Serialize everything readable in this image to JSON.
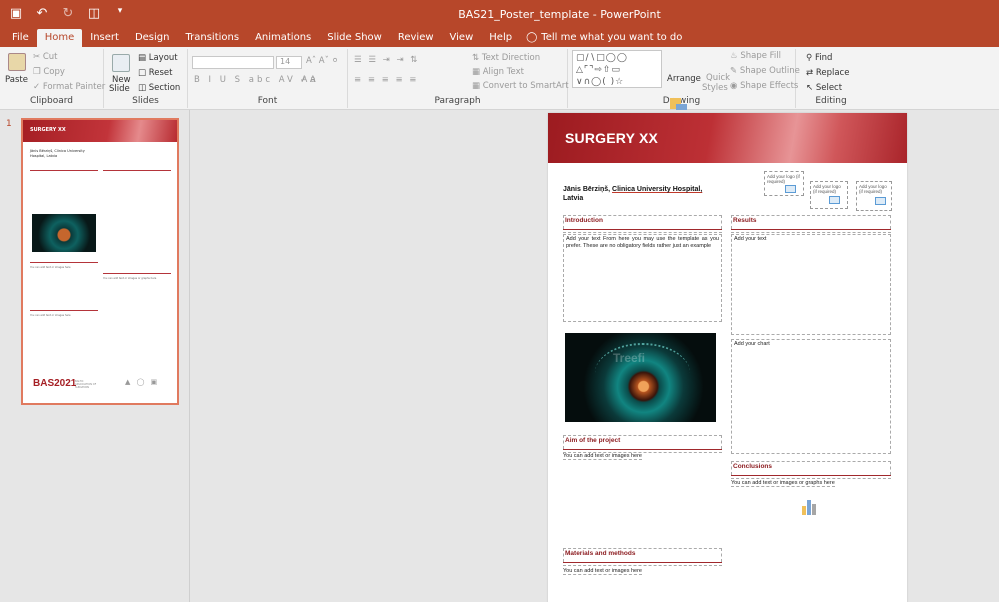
{
  "window": {
    "title": "BAS21_Poster_template  -  PowerPoint"
  },
  "quick_access": {
    "icons": [
      "save-icon",
      "undo-icon",
      "redo-icon",
      "present-icon",
      "customize-icon"
    ]
  },
  "tabs": [
    {
      "label": "File"
    },
    {
      "label": "Home",
      "active": true
    },
    {
      "label": "Insert"
    },
    {
      "label": "Design"
    },
    {
      "label": "Transitions"
    },
    {
      "label": "Animations"
    },
    {
      "label": "Slide Show"
    },
    {
      "label": "Review"
    },
    {
      "label": "View"
    },
    {
      "label": "Help"
    }
  ],
  "tell_me": "Tell me what you want to do",
  "ribbon": {
    "clipboard": {
      "label": "Clipboard",
      "paste": "Paste",
      "cut": "Cut",
      "copy": "Copy",
      "format_painter": "Format Painter"
    },
    "slides": {
      "label": "Slides",
      "new_slide": "New",
      "new_slide2": "Slide",
      "layout": "Layout",
      "reset": "Reset",
      "section": "Section"
    },
    "font": {
      "label": "Font",
      "size": "14"
    },
    "paragraph": {
      "label": "Paragraph",
      "text_direction": "Text Direction",
      "align_text": "Align Text",
      "convert_smartart": "Convert to SmartArt"
    },
    "drawing": {
      "label": "Drawing",
      "arrange": "Arrange",
      "quick_styles": "Quick",
      "quick_styles2": "Styles",
      "shape_fill": "Shape Fill",
      "shape_outline": "Shape Outline",
      "shape_effects": "Shape Effects"
    },
    "editing": {
      "label": "Editing",
      "find": "Find",
      "replace": "Replace",
      "select": "Select"
    }
  },
  "thumbnail": {
    "number": "1",
    "title": "SURGERY XX",
    "author": "Jānis Bērziņš, Clinica University Hospital, Latvia",
    "caption": "You can add text or images here",
    "caption2": "You can add text or images or graphs here",
    "footer": "BAS2021",
    "footer_sub": "BALTIC ASSOCIATION OF SURGEONS"
  },
  "slide": {
    "title": "SURGERY XX",
    "author_name": "Jānis Bērziņš, ",
    "author_affil": "Clinica University Hospital,",
    "author_country": "Latvia",
    "logos": [
      {
        "text": "Add your logo (if required)"
      },
      {
        "text": "Add your logo (if required)"
      },
      {
        "text": "Add your logo (if required)"
      }
    ],
    "sections": {
      "introduction": {
        "title": "Introduction",
        "body": "Add your text From here you may use the template as you prefer. These are no obligatory fields rather just an example"
      },
      "results": {
        "title": "Results",
        "body": "Add your text"
      },
      "chart": {
        "body": "Add your chart"
      },
      "aim": {
        "title": "Aim of the project",
        "body": "You can add text or images here"
      },
      "conclusions": {
        "title": "Conclusions",
        "body": "You can add text or images or graphs here"
      },
      "materials": {
        "title": "Materials and methods",
        "body": "You can add text or images here"
      }
    },
    "image_watermark": "Treefi"
  },
  "colors": {
    "accent": "#b7472a",
    "poster_red": "#a51f24",
    "section_title": "#8b1a1e"
  }
}
